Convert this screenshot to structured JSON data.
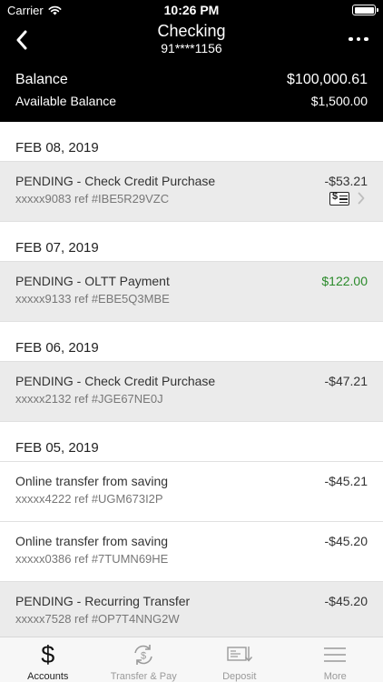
{
  "status_bar": {
    "carrier": "Carrier",
    "time": "10:26 PM"
  },
  "nav": {
    "title": "Checking",
    "subtitle": "91****1156"
  },
  "summary": {
    "balance_label": "Balance",
    "balance_value": "$100,000.61",
    "available_label": "Available Balance",
    "available_value": "$1,500.00"
  },
  "colors": {
    "header_bg": "#000000",
    "pending_bg": "#ebebeb",
    "credit_green": "#2a8a2a"
  },
  "groups": [
    {
      "date": "FEB 08, 2019",
      "transactions": [
        {
          "description": "PENDING - Check Credit Purchase",
          "ref": "xxxxx9083 ref #IBE5R29VZC",
          "amount": "-$53.21",
          "pending": true,
          "has_check_image": true
        }
      ]
    },
    {
      "date": "FEB 07, 2019",
      "transactions": [
        {
          "description": "PENDING - OLTT Payment",
          "ref": "xxxxx9133 ref #EBE5Q3MBE",
          "amount": "$122.00",
          "pending": true,
          "credit": true
        }
      ]
    },
    {
      "date": "FEB 06, 2019",
      "transactions": [
        {
          "description": "PENDING - Check Credit Purchase",
          "ref": "xxxxx2132 ref #JGE67NE0J",
          "amount": "-$47.21",
          "pending": true
        }
      ]
    },
    {
      "date": "FEB 05, 2019",
      "transactions": [
        {
          "description": "Online transfer from saving",
          "ref": "xxxxx4222 ref #UGM673I2P",
          "amount": "-$45.21",
          "pending": false
        },
        {
          "description": "Online transfer from saving",
          "ref": "xxxxx0386 ref #7TUMN69HE",
          "amount": "-$45.20",
          "pending": false
        },
        {
          "description": "PENDING - Recurring Transfer",
          "ref": "xxxxx7528 ref #OP7T4NNG2W",
          "amount": "-$45.20",
          "pending": true
        }
      ]
    }
  ],
  "tabbar": {
    "tabs": [
      {
        "label": "Accounts",
        "icon": "dollar-icon",
        "active": true
      },
      {
        "label": "Transfer & Pay",
        "icon": "transfer-icon",
        "active": false
      },
      {
        "label": "Deposit",
        "icon": "deposit-check-icon",
        "active": false
      },
      {
        "label": "More",
        "icon": "menu-icon",
        "active": false
      }
    ]
  }
}
